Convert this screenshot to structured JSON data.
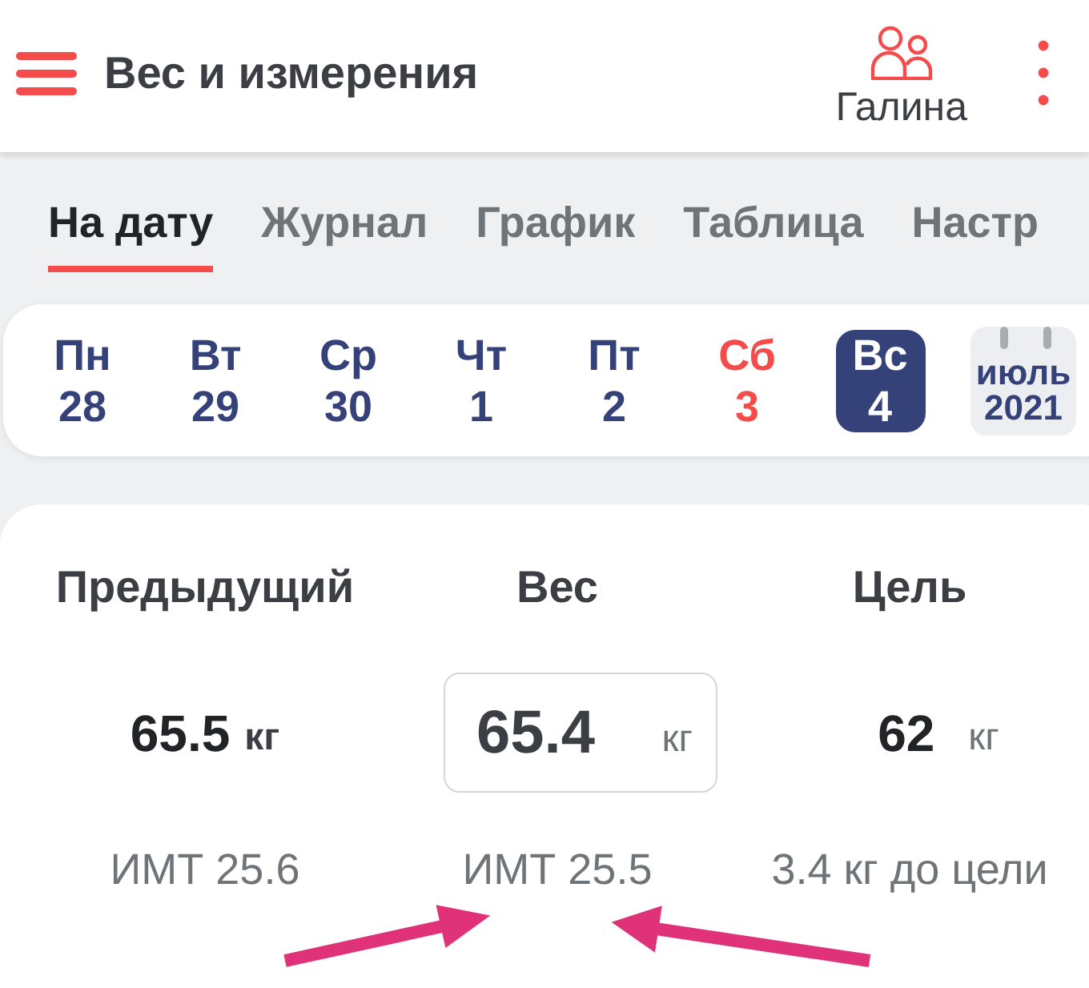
{
  "app_bar": {
    "title": "Вес и измерения",
    "profile": {
      "name": "Галина"
    }
  },
  "tabs": [
    {
      "label": "На дату",
      "selected": true
    },
    {
      "label": "Журнал",
      "selected": false
    },
    {
      "label": "График",
      "selected": false
    },
    {
      "label": "Таблица",
      "selected": false
    },
    {
      "label": "Настр",
      "selected": false
    }
  ],
  "week": {
    "days": [
      {
        "weekday": "Пн",
        "date": "28",
        "selected": false,
        "color": "#354279"
      },
      {
        "weekday": "Вт",
        "date": "29",
        "selected": false,
        "color": "#354279"
      },
      {
        "weekday": "Ср",
        "date": "30",
        "selected": false,
        "color": "#354279"
      },
      {
        "weekday": "Чт",
        "date": "1",
        "selected": false,
        "color": "#354279"
      },
      {
        "weekday": "Пт",
        "date": "2",
        "selected": false,
        "color": "#354279"
      },
      {
        "weekday": "Сб",
        "date": "3",
        "selected": false,
        "color": "#f44b4b"
      },
      {
        "weekday": "Вс",
        "date": "4",
        "selected": true,
        "color": "#354279"
      }
    ],
    "month": {
      "month": "июль",
      "year": "2021"
    }
  },
  "weight": {
    "columns": [
      {
        "kind": "previous",
        "title": "Предыдущий",
        "value": "65.5",
        "unit": "кг",
        "note": "ИМТ 25.6"
      },
      {
        "kind": "input",
        "title": "Вес",
        "value": "65.4",
        "unit": "кг",
        "note": "ИМТ 25.5"
      },
      {
        "kind": "goal",
        "title": "Цель",
        "value": "62",
        "unit": "кг",
        "note": "3.4 кг до цели"
      }
    ]
  }
}
